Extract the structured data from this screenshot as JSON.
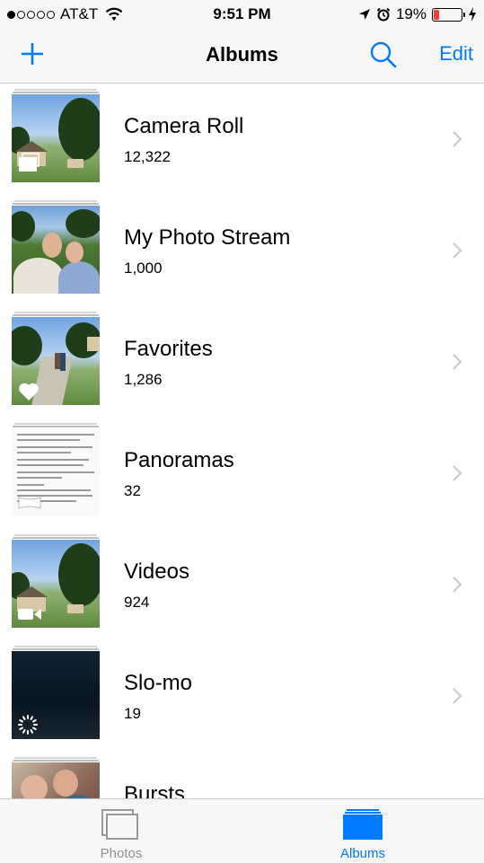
{
  "status_bar": {
    "signal_filled": 1,
    "signal_total": 5,
    "carrier": "AT&T",
    "time": "9:51 PM",
    "battery_percent": "19%",
    "battery_level": 0.19,
    "icons": [
      "wifi-icon",
      "location-arrow-icon",
      "alarm-icon",
      "battery-icon",
      "charging-bolt-icon"
    ]
  },
  "nav": {
    "title": "Albums",
    "edit_label": "Edit",
    "accent_color": "#007aff",
    "icons": [
      "plus-icon",
      "search-icon"
    ]
  },
  "albums": [
    {
      "title": "Camera Roll",
      "count": "12,322",
      "badge_icon": "stack-icon"
    },
    {
      "title": "My Photo Stream",
      "count": "1,000",
      "badge_icon": ""
    },
    {
      "title": "Favorites",
      "count": "1,286",
      "badge_icon": "heart-icon"
    },
    {
      "title": "Panoramas",
      "count": "32",
      "badge_icon": "panorama-icon"
    },
    {
      "title": "Videos",
      "count": "924",
      "badge_icon": "video-camera-icon"
    },
    {
      "title": "Slo-mo",
      "count": "19",
      "badge_icon": "slow-motion-icon"
    },
    {
      "title": "Bursts",
      "count": "",
      "badge_icon": ""
    }
  ],
  "tab_bar": {
    "tabs": [
      {
        "label": "Photos",
        "icon": "photos-icon",
        "selected": false
      },
      {
        "label": "Albums",
        "icon": "albums-icon",
        "selected": true
      }
    ],
    "inactive_color": "#8e8e93",
    "active_color": "#007aff"
  }
}
